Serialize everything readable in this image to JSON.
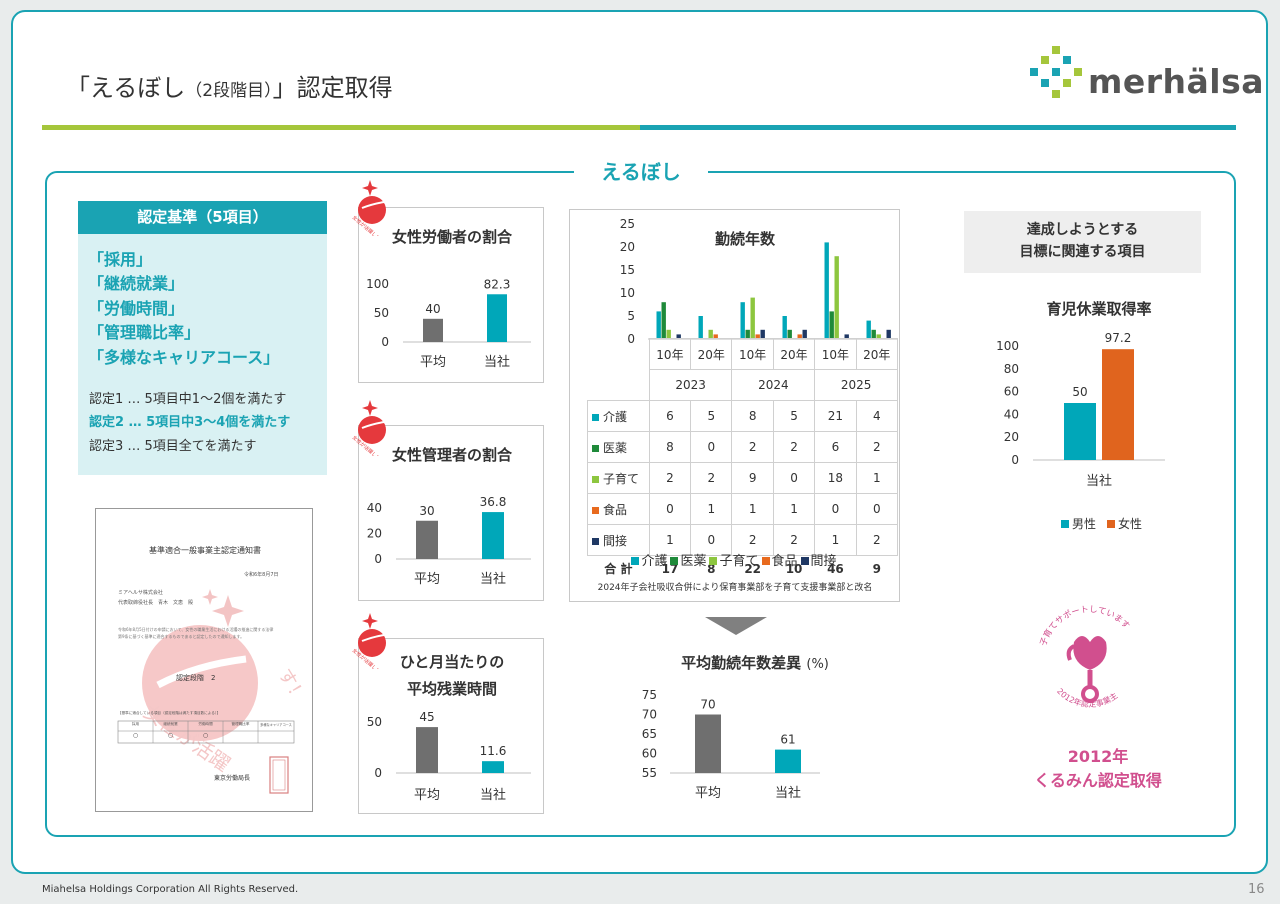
{
  "header": {
    "title_open": "「えるぼし",
    "title_small": "（2段階目）",
    "title_close": "」認定取得",
    "logo_text": "merhälsa"
  },
  "section_title": "えるぼし",
  "criteria": {
    "heading": "認定基準（5項目）",
    "items": [
      "「採用」",
      "「継続就業」",
      "「労働時間」",
      "「管理職比率」",
      "「多様なキャリアコース」"
    ],
    "levels": [
      "認定1 … 5項目中1～2個を満たす",
      "認定2 … 5項目中3～4個を満たす",
      "認定3 … 5項目全てを満たす"
    ]
  },
  "certificate": {
    "title": "基準適合一般事業主認定通知書",
    "date": "令和6年8月7日",
    "company": "ミアヘルサ株式会社",
    "rep": "代表取締役社長　青木　文恵　殿",
    "body1": "令和6年8月5日付けの申請において、女性の職業生活における活躍の推進に関する法律",
    "body2": "第9条に基づく基準に適合するものであると認定したので通知します。",
    "stage": "認定段階　2",
    "table_caption": "【基準に適合している項目（認定段階は満たす項目数による）】",
    "cols": [
      "採用",
      "継続就業",
      "労働時間",
      "管理職比率",
      "多様なキャリアコース"
    ],
    "marks": [
      "○",
      "○",
      "○",
      "",
      ""
    ],
    "issuer": "東京労働局長"
  },
  "badge_text": "女性が活躍しています！",
  "charts": [
    {
      "type": "bar",
      "title": "女性労働者の割合",
      "categories": [
        "平均",
        "当社"
      ],
      "values": [
        40,
        82.3
      ],
      "ylim": [
        0,
        100
      ],
      "yticks": [
        0,
        50,
        100
      ],
      "colors": [
        "#6f6f6f",
        "#00a7b9"
      ]
    },
    {
      "type": "bar",
      "title": "女性管理者の割合",
      "categories": [
        "平均",
        "当社"
      ],
      "values": [
        30,
        36.8
      ],
      "ylim": [
        0,
        40
      ],
      "yticks": [
        0,
        20,
        40
      ],
      "colors": [
        "#6f6f6f",
        "#00a7b9"
      ]
    },
    {
      "type": "bar",
      "title_lines": [
        "ひと月当たりの",
        "平均残業時間"
      ],
      "categories": [
        "平均",
        "当社"
      ],
      "values": [
        45,
        11.6
      ],
      "ylim": [
        0,
        50
      ],
      "yticks": [
        0,
        50
      ],
      "colors": [
        "#6f6f6f",
        "#00a7b9"
      ]
    },
    {
      "type": "bar",
      "title": "勤続年数",
      "ylim": [
        0,
        25
      ],
      "yticks": [
        0,
        5,
        10,
        15,
        20,
        25
      ],
      "groups": [
        {
          "year": "2023",
          "cats": [
            "10年",
            "20年"
          ]
        },
        {
          "year": "2024",
          "cats": [
            "10年",
            "20年"
          ]
        },
        {
          "year": "2025",
          "cats": [
            "10年",
            "20年"
          ]
        }
      ],
      "series": [
        {
          "name": "介護",
          "color": "#00a7b9",
          "values": [
            6,
            5,
            8,
            5,
            21,
            4
          ]
        },
        {
          "name": "医薬",
          "color": "#1f8a3a",
          "values": [
            8,
            0,
            2,
            2,
            6,
            2
          ]
        },
        {
          "name": "子育て",
          "color": "#8dc63f",
          "values": [
            2,
            2,
            9,
            0,
            18,
            1
          ]
        },
        {
          "name": "食品",
          "color": "#e86a1e",
          "values": [
            0,
            1,
            1,
            1,
            0,
            0
          ]
        },
        {
          "name": "間接",
          "color": "#1f3864",
          "values": [
            1,
            0,
            2,
            2,
            1,
            2
          ]
        }
      ],
      "total_label": "合 計",
      "totals": [
        17,
        8,
        22,
        10,
        46,
        9
      ]
    },
    {
      "type": "bar",
      "title": "平均勤続年数差異",
      "unit": "(%)",
      "categories": [
        "平均",
        "当社"
      ],
      "values": [
        70,
        61
      ],
      "ylim": [
        55,
        75
      ],
      "yticks": [
        55,
        60,
        65,
        70,
        75
      ],
      "colors": [
        "#6f6f6f",
        "#00a7b9"
      ]
    },
    {
      "type": "bar",
      "title": "育児休業取得率",
      "category": "当社",
      "ylim": [
        0,
        100
      ],
      "yticks": [
        0,
        20,
        40,
        60,
        80,
        100
      ],
      "series": [
        {
          "name": "男性",
          "value": 50,
          "color": "#00a7b9"
        },
        {
          "name": "女性",
          "value": 97.2,
          "color": "#e0641e"
        }
      ]
    }
  ],
  "tenure_note": "2024年子会社吸収合併により保育事業部を子育て支援事業部と改名",
  "goal_box": [
    "達成しようとする",
    "目標に関連する項目"
  ],
  "kurumin": {
    "arc_text": "子育てサポートしています",
    "year_text": "2012年認定事業主",
    "label": [
      "2012年",
      "くるみん認定取得"
    ]
  },
  "footer": {
    "copyright": "Miahelsa Holdings Corporation All Rights Reserved.",
    "page": "16"
  }
}
